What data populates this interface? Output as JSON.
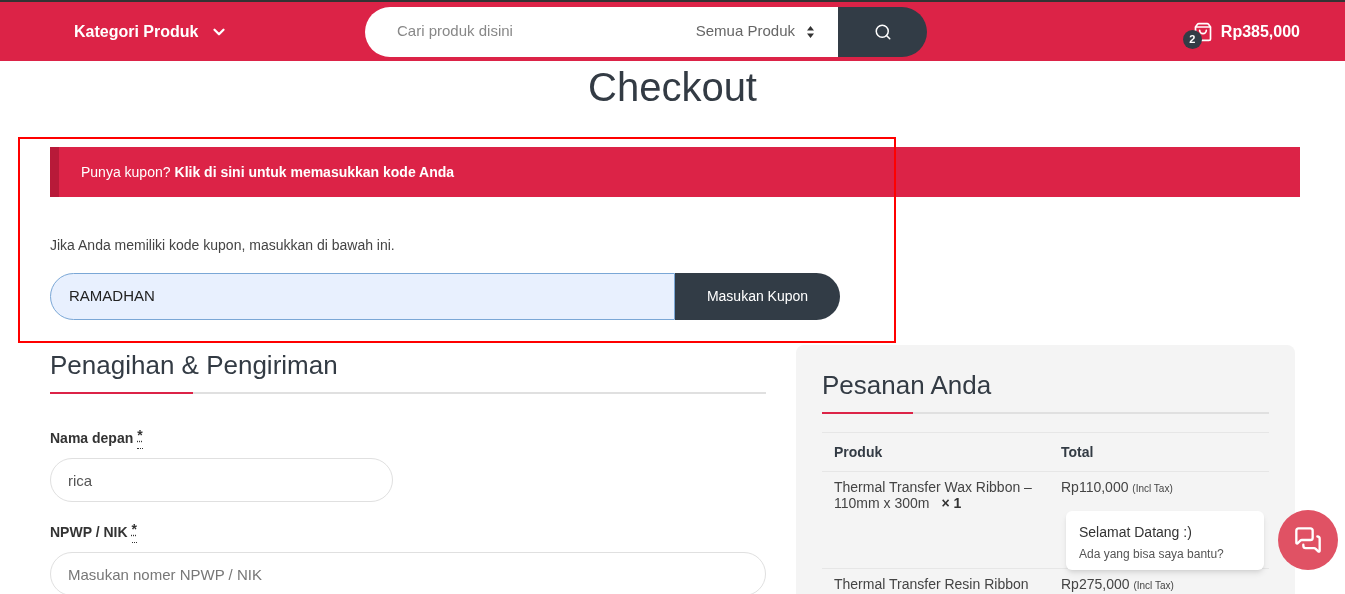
{
  "header": {
    "category_menu": "Kategori Produk",
    "search": {
      "placeholder": "Cari produk disini",
      "scope": "Semua Produk"
    },
    "cart": {
      "count": "2",
      "total": "Rp385,000"
    }
  },
  "page_title": "Checkout",
  "coupon_notice": {
    "text": "Punya kupon?",
    "link": "Klik di sini untuk memasukkan kode Anda"
  },
  "coupon_form": {
    "hint": "Jika Anda memiliki kode kupon, masukkan di bawah ini.",
    "value": "RAMADHAN",
    "button": "Masukan Kupon"
  },
  "billing": {
    "title": "Penagihan & Pengiriman",
    "fields": [
      {
        "label": "Nama depan",
        "required": "*",
        "value": "rica",
        "half_width": true
      },
      {
        "label": "NPWP / NIK",
        "required": "*",
        "placeholder": "Masukan nomer NPWP / NIK",
        "half_width": false
      }
    ]
  },
  "order": {
    "title": "Pesanan Anda",
    "columns": [
      "Produk",
      "Total"
    ],
    "rows": [
      {
        "product": "Thermal Transfer Wax Ribbon – 110mm x 300m",
        "quantity": "× 1",
        "price": "Rp110,000",
        "tax_note": "(Incl Tax)"
      },
      {
        "product": "Thermal Transfer Resin Ribbon",
        "price": "Rp275,000",
        "tax_note": "(Incl Tax)"
      }
    ]
  },
  "chat": {
    "title": "Selamat Datang :)",
    "message": "Ada yang bisa saya bantu?"
  }
}
